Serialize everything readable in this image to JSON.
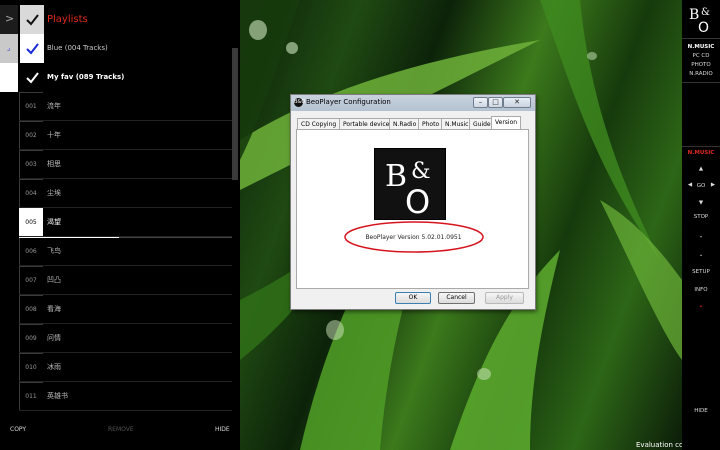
{
  "left_panel": {
    "title": "Playlists",
    "expander_glyph": ">",
    "playlists": [
      {
        "label": "Blue (004 Tracks)",
        "checked": true
      },
      {
        "label": "My fav (089 Tracks)",
        "checked": true
      }
    ],
    "tracks": [
      {
        "num": "001",
        "title": "流年"
      },
      {
        "num": "002",
        "title": "十年"
      },
      {
        "num": "003",
        "title": "相思"
      },
      {
        "num": "004",
        "title": "尘埃"
      },
      {
        "num": "005",
        "title": "渴望"
      },
      {
        "num": "006",
        "title": "飞鸟"
      },
      {
        "num": "007",
        "title": "凹凸"
      },
      {
        "num": "008",
        "title": "看海"
      },
      {
        "num": "009",
        "title": "问情"
      },
      {
        "num": "010",
        "title": "冰雨"
      },
      {
        "num": "011",
        "title": "英雄书"
      }
    ],
    "selected_track_index": 4,
    "progress_fraction": 0.47,
    "bottom": {
      "copy": "COPY",
      "remove": "REMOVE",
      "hide": "HIDE"
    }
  },
  "dialog": {
    "title": "BeoPlayer Configuration",
    "title_icon": "B&O",
    "window_buttons": {
      "minimize": "–",
      "maximize": "□",
      "close": "✕"
    },
    "tabs": [
      "CD Copying",
      "Portable devices",
      "N.Radio",
      "Photo",
      "N.Music",
      "Guide",
      "Version"
    ],
    "active_tab": "Version",
    "logo": {
      "top": "B",
      "amp": "&",
      "bottom": "O"
    },
    "version_text": "BeoPlayer Version 5.02.01.0951",
    "buttons": {
      "ok": "OK",
      "cancel": "Cancel",
      "apply": "Apply"
    }
  },
  "desktop": {
    "evaluation_text": "Evaluation copy"
  },
  "right_panel": {
    "sources": [
      "N.MUSIC",
      "PC CD",
      "PHOTO",
      "N.RADIO"
    ],
    "active_source": "N.MUSIC",
    "up_arrow": "▲",
    "left_arrow": "◀",
    "go": "GO",
    "right_arrow": "▶",
    "down_arrow": "▼",
    "stop": "STOP",
    "up2": "⌃",
    "down2": "⌄",
    "setup": "SETUP",
    "info": "INFO",
    "dot": "•",
    "hide": "HIDE"
  },
  "colors": {
    "accent_red": "#e02a1c",
    "panel_bg": "#000000",
    "dialog_bg": "#f0f0f0",
    "ellipse_red": "#d6141e"
  }
}
